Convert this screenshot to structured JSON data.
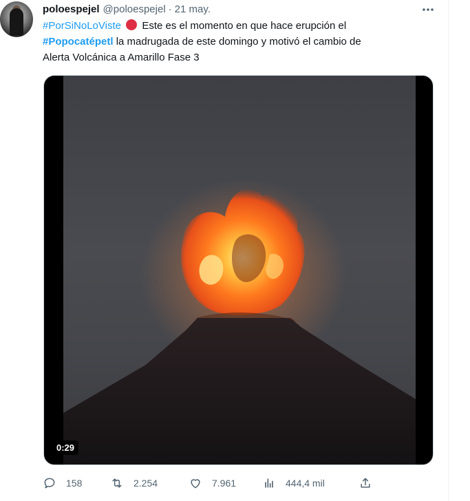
{
  "tweet": {
    "author": {
      "display_name": "poloespejel",
      "handle": "@poloespejel",
      "separator": "·",
      "date": "21 may."
    },
    "text": {
      "hashtag1": "#PorSiNoLoViste",
      "line1_rest": "Este es el momento en que hace erupción el",
      "hashtag2": "#Popocatépetl",
      "line2_rest": "la madrugada de este domingo y motivó el cambio de",
      "line3": "Alerta Volcánica a Amarillo Fase 3"
    },
    "media": {
      "duration": "0:29"
    },
    "actions": {
      "replies": "158",
      "retweets": "2.254",
      "likes": "7.961",
      "views": "444,4 mil"
    }
  },
  "icons": {
    "more": "more-icon",
    "reply": "reply-icon",
    "retweet": "retweet-icon",
    "like": "heart-icon",
    "views": "analytics-icon",
    "share": "share-icon",
    "status_emoji": "red-circle-icon"
  },
  "colors": {
    "link": "#1d9bf0",
    "text": "#0f1419",
    "secondary": "#536471",
    "emoji_red": "#dd2e44"
  }
}
